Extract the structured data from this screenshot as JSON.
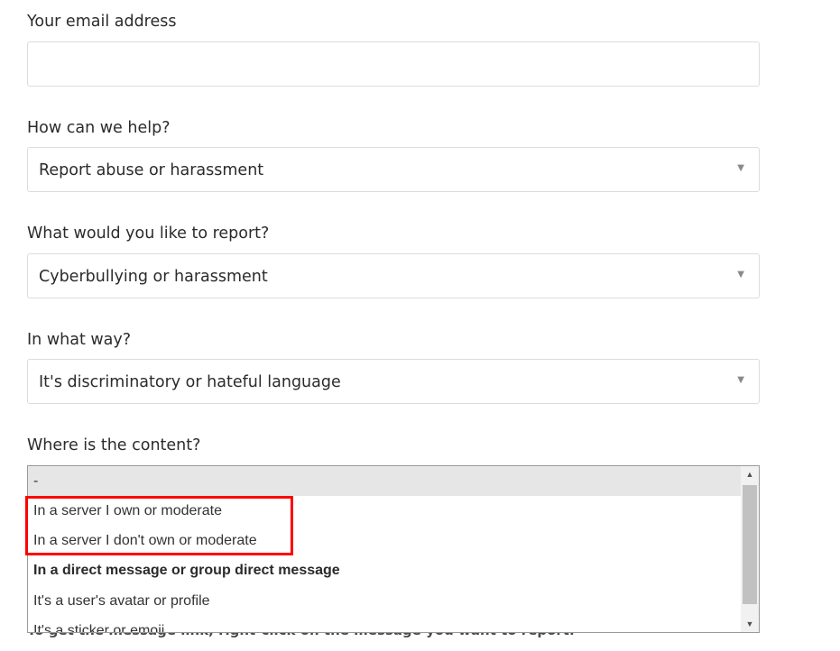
{
  "form": {
    "email": {
      "label": "Your email address",
      "value": ""
    },
    "help": {
      "label": "How can we help?",
      "value": "Report abuse or harassment"
    },
    "report": {
      "label": "What would you like to report?",
      "value": "Cyberbullying or harassment"
    },
    "way": {
      "label": "In what way?",
      "value": "It's discriminatory or hateful language"
    },
    "location": {
      "label": "Where is the content?",
      "options": [
        "-",
        "In a server I own or moderate",
        "In a server I don't own or moderate",
        "In a direct message or group direct message",
        "It's a user's avatar or profile",
        "It's a sticker or emoji"
      ]
    },
    "hint": "To get the message link, right-click on the message you want to report."
  },
  "icons": {
    "dropdown_caret": "caret-down-icon",
    "scroll_up": "scroll-up-arrow-icon",
    "scroll_down": "scroll-down-arrow-icon"
  },
  "colors": {
    "highlight_border": "#ff0000",
    "selected_option_bg": "#e6e6e6",
    "field_border": "#dcdcdc"
  }
}
